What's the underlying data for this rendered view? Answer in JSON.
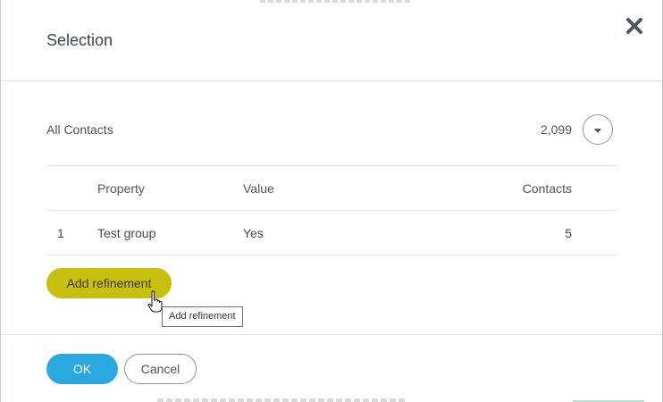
{
  "dialog": {
    "title": "Selection",
    "close_icon": "close-icon"
  },
  "summary": {
    "label": "All Contacts",
    "count": "2,099",
    "dropdown_icon": "chevron-down-icon"
  },
  "table": {
    "columns": [
      "",
      "Property",
      "Value",
      "Contacts"
    ],
    "rows": [
      {
        "index": "1",
        "property": "Test group",
        "value": "Yes",
        "contacts": "5"
      }
    ]
  },
  "actions": {
    "add_refinement_label": "Add refinement",
    "tooltip": "Add refinement"
  },
  "footer": {
    "ok_label": "OK",
    "cancel_label": "Cancel"
  },
  "colors": {
    "accent_yellow": "#c9bf0e",
    "primary_blue": "#2ba8e0",
    "text": "#3d4b57"
  }
}
